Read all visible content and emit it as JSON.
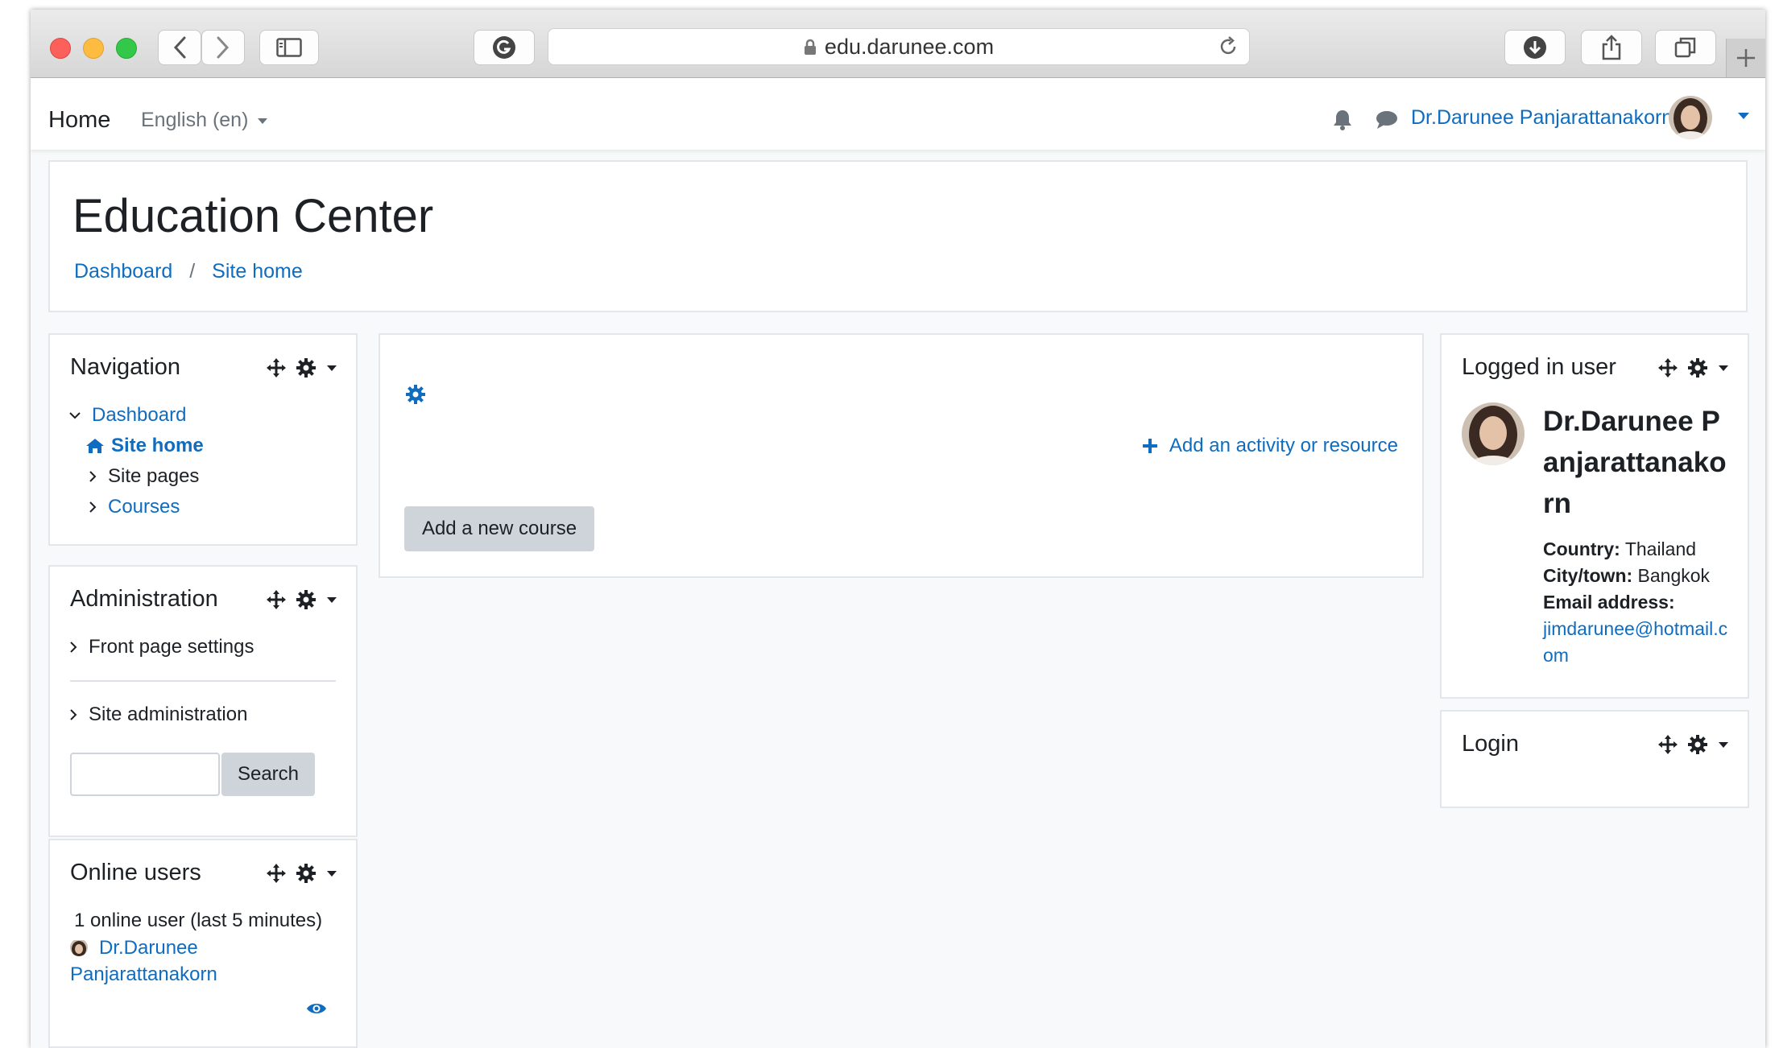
{
  "browser": {
    "url": "edu.darunee.com"
  },
  "navbar": {
    "home_label": "Home",
    "language_label": "English (en)",
    "user_name": "Dr.Darunee Panjarattanakorn"
  },
  "header": {
    "title": "Education Center",
    "breadcrumbs": [
      "Dashboard",
      "Site home"
    ]
  },
  "navigation_block": {
    "title": "Navigation",
    "items": [
      {
        "label": "Dashboard"
      },
      {
        "label": "Site home"
      },
      {
        "label": "Site pages"
      },
      {
        "label": "Courses"
      }
    ]
  },
  "administration_block": {
    "title": "Administration",
    "items": [
      {
        "label": "Front page settings"
      },
      {
        "label": "Site administration"
      }
    ],
    "search_button": "Search"
  },
  "online_users_block": {
    "title": "Online users",
    "summary": "1 online user (last 5 minutes)",
    "users": [
      "Dr.Darunee Panjarattanakorn"
    ]
  },
  "main": {
    "add_activity_label": "Add an activity or resource",
    "add_course_label": "Add a new course"
  },
  "logged_in_block": {
    "title": "Logged in user",
    "name": "Dr.Darunee Panjarattanakorn",
    "country_label": "Country:",
    "country_value": "Thailand",
    "city_label": "City/town:",
    "city_value": "Bangkok",
    "email_label": "Email address:",
    "email_value": "jimdarunee@hotmail.com"
  },
  "login_block": {
    "title": "Login"
  },
  "colors": {
    "link": "#0f6cbf",
    "text": "#1d2125",
    "muted": "#6a737b",
    "border": "#e3e6ea",
    "button_bg": "#ced4da"
  },
  "icons": [
    "back-icon",
    "forward-icon",
    "sidebar-icon",
    "grammarly-icon",
    "lock-icon",
    "reload-icon",
    "download-icon",
    "share-icon",
    "tabs-icon",
    "plus-icon",
    "bell-icon",
    "chat-icon",
    "move-icon",
    "gear-icon",
    "home-icon",
    "eye-icon"
  ]
}
